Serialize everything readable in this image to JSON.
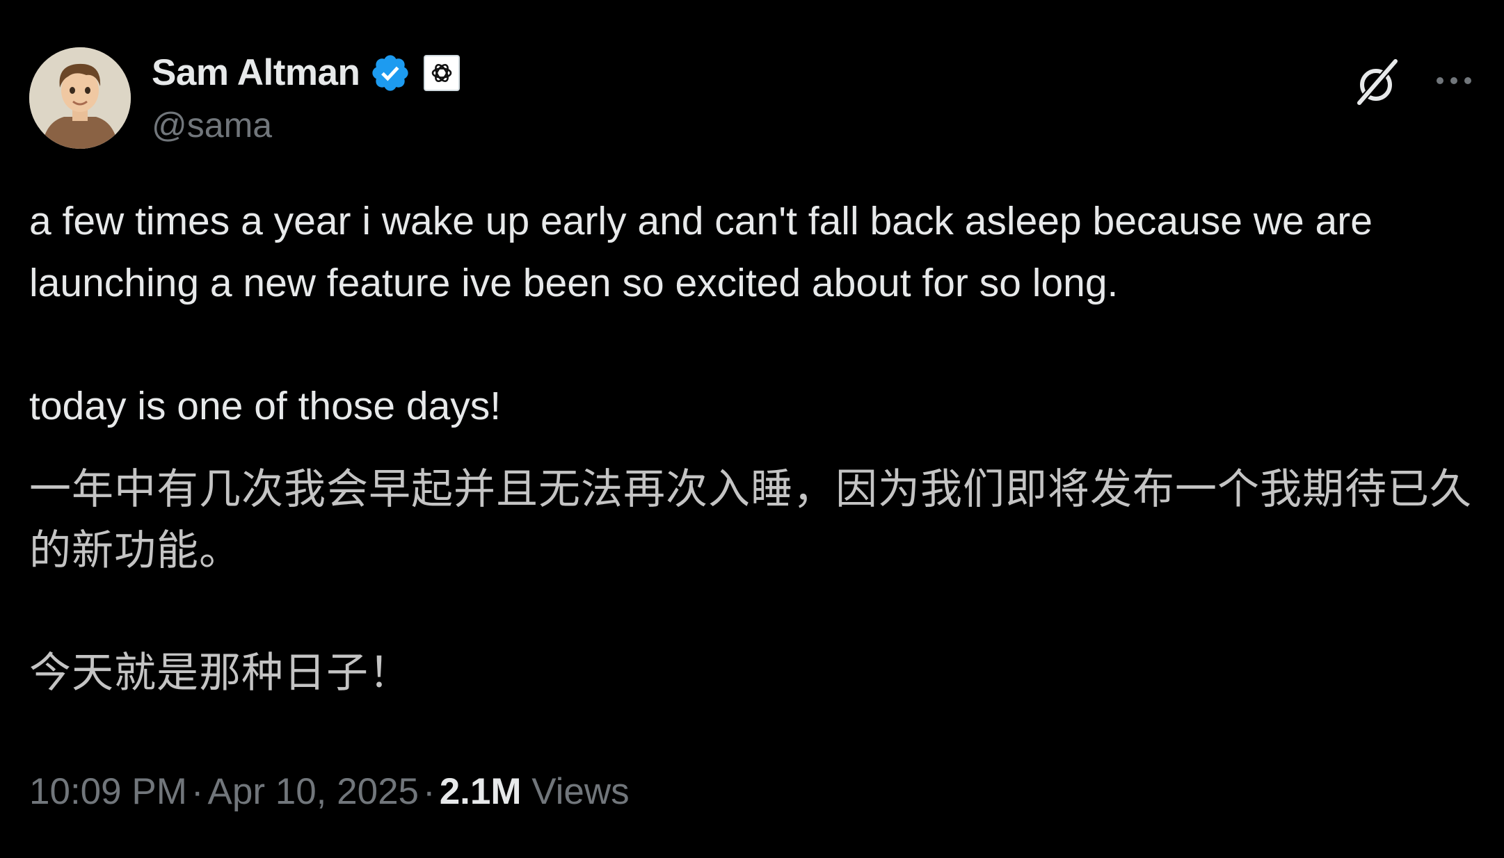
{
  "author": {
    "display_name": "Sam Altman",
    "handle": "@sama",
    "verified": true,
    "affiliation": "openai-logo-icon",
    "verified_color": "#1d9bf0"
  },
  "header_actions": {
    "grok_icon": "grok-icon",
    "more_icon": "more-icon"
  },
  "tweet": {
    "paragraph_en_1": "a few times a year i wake up early and can't fall back asleep because we are launching a new feature ive been so excited about for so long.",
    "paragraph_en_2": "today is one of those days!",
    "paragraph_zh_1": "一年中有几次我会早起并且无法再次入睡，因为我们即将发布一个我期待已久的新功能。",
    "paragraph_zh_2": "今天就是那种日子！"
  },
  "meta": {
    "time": "10:09 PM",
    "separator": "·",
    "date": "Apr 10, 2025",
    "views_count": "2.1M",
    "views_label": "Views"
  },
  "colors": {
    "background": "#000000",
    "primary_text": "#e7e9ea",
    "secondary_text": "#71767b"
  }
}
